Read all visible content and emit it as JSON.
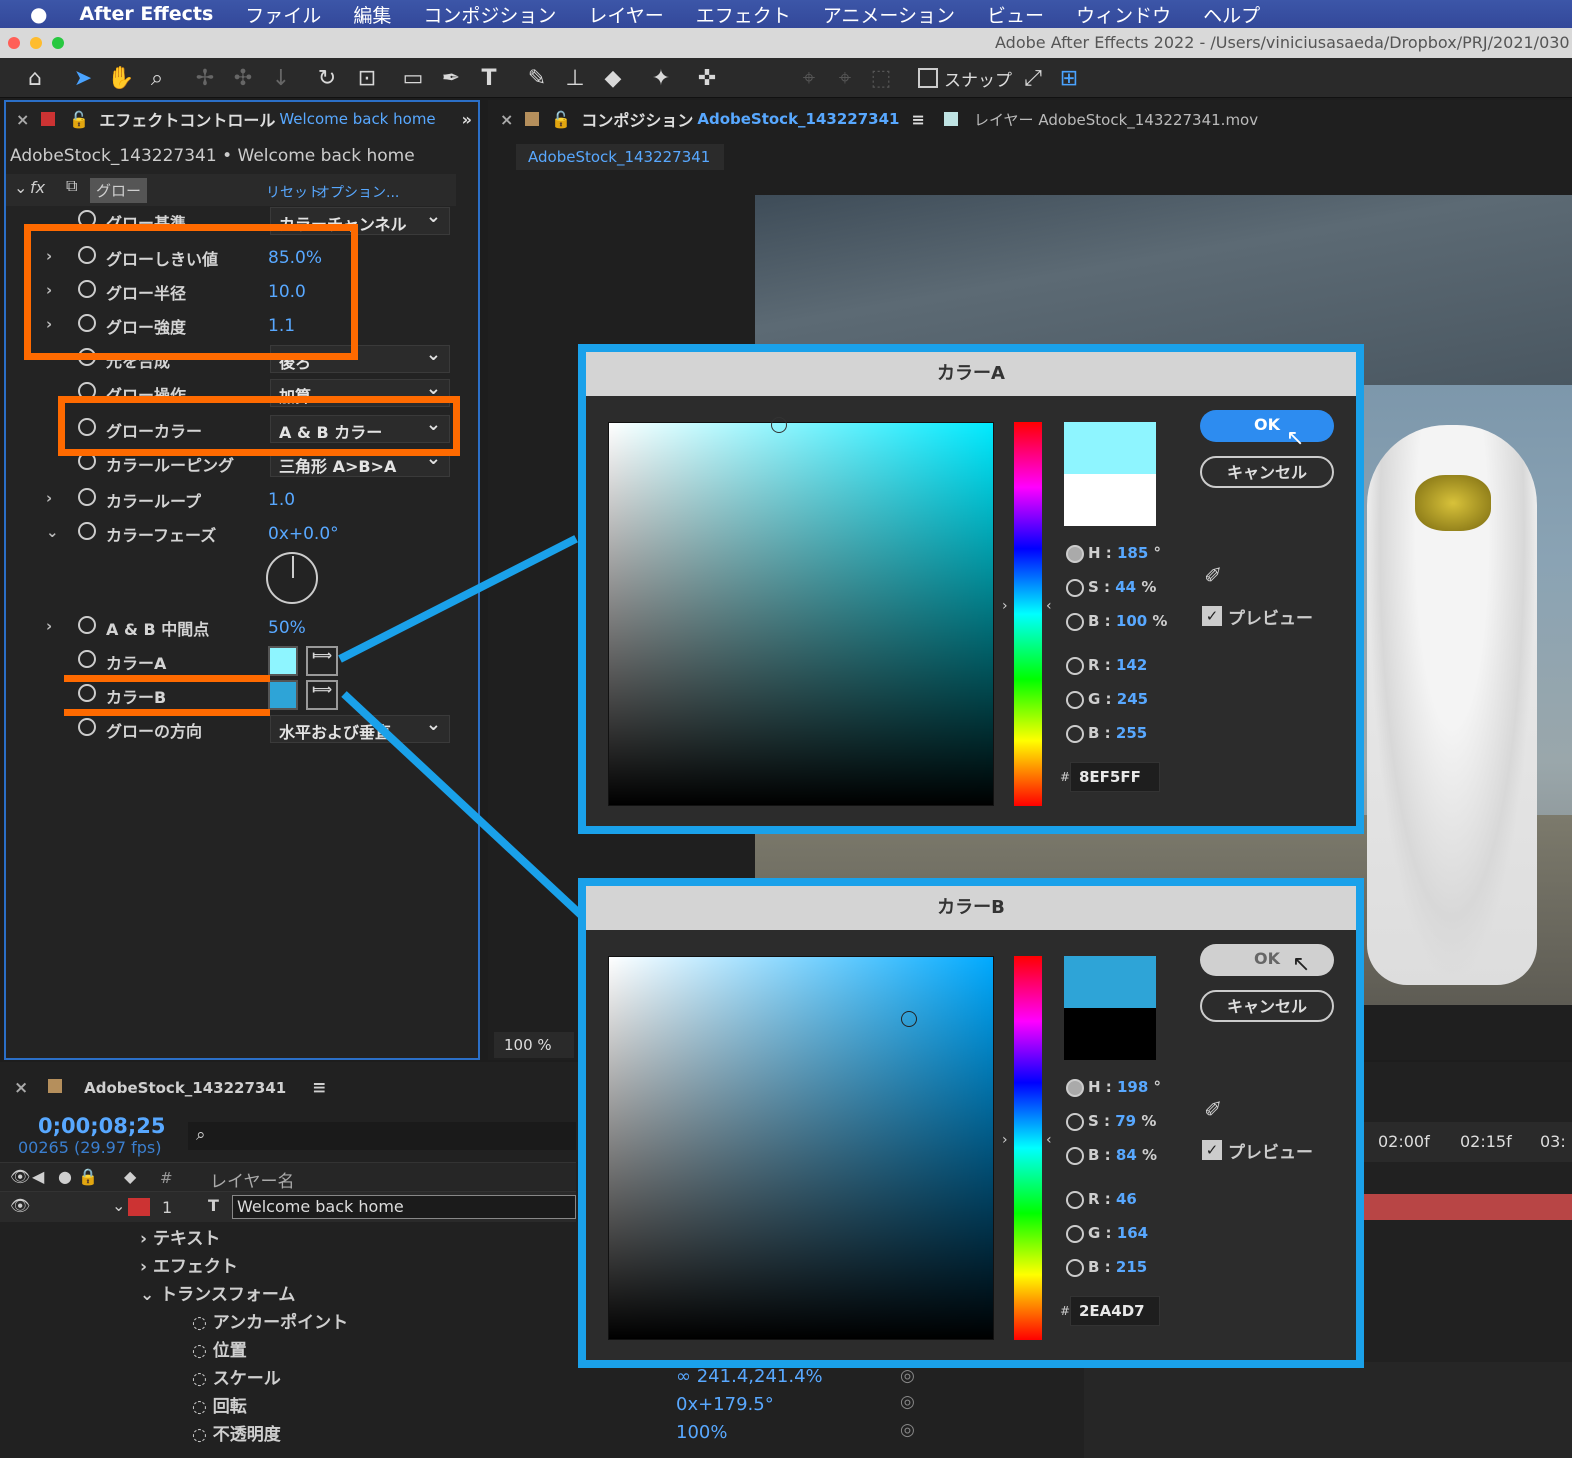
{
  "menubar": {
    "items": [
      "After Effects",
      "ファイル",
      "編集",
      "コンポジション",
      "レイヤー",
      "エフェクト",
      "アニメーション",
      "ビュー",
      "ウィンドウ",
      "ヘルプ"
    ]
  },
  "titlebar": {
    "title": "Adobe After Effects 2022 - /Users/viniciusasaeda/Dropbox/PRJ/2021/030"
  },
  "toolbar": {
    "snap_label": "スナップ"
  },
  "effect_panel": {
    "tab_title": "エフェクトコントロール",
    "tab_layer": "Welcome back home",
    "subtitle": "AdobeStock_143227341 • Welcome back home",
    "effect_name": "グロー",
    "reset": "リセット",
    "options": "オプション...",
    "rows": [
      {
        "label": "グロー基準",
        "value": "カラーチャンネル"
      },
      {
        "label": "グローしきい値",
        "value": "85.0%"
      },
      {
        "label": "グロー半径",
        "value": "10.0"
      },
      {
        "label": "グロー強度",
        "value": "1.1"
      },
      {
        "label": "元を合成",
        "value": "後ろ"
      },
      {
        "label": "グロー操作",
        "value": "加算"
      },
      {
        "label": "グローカラー",
        "value": "A & B カラー"
      },
      {
        "label": "カラールーピング",
        "value": "三角形 A>B>A"
      },
      {
        "label": "カラーループ",
        "value": "1.0"
      },
      {
        "label": "カラーフェーズ",
        "value": "0x+0.0°"
      },
      {
        "label": "A & B 中間点",
        "value": "50%"
      },
      {
        "label": "カラーA",
        "value": ""
      },
      {
        "label": "カラーB",
        "value": ""
      },
      {
        "label": "グローの方向",
        "value": "水平および垂直"
      }
    ]
  },
  "comp_panel": {
    "tab_title": "コンポジション",
    "tab_comp": "AdobeStock_143227341",
    "layer_tab": "レイヤー AdobeStock_143227341.mov",
    "subtab": "AdobeStock_143227341",
    "zoom": "100 %"
  },
  "timeline": {
    "comp_name": "AdobeStock_143227341",
    "timecode": "0;00;08;25",
    "frames": "00265 (29.97 fps)",
    "col_num": "#",
    "col_layer": "レイヤー名",
    "layer_num": "1",
    "layer_name": "Welcome back home",
    "children": [
      "テキスト",
      "エフェクト",
      "トランスフォーム"
    ],
    "transform": [
      "アンカーポイント",
      "位置",
      "スケール",
      "回転",
      "不透明度"
    ],
    "scale_value": "241.4,241.4%",
    "rotation_value": "0x+179.5°",
    "opacity_value": "100%",
    "ruler": [
      "02:00f",
      "02:15f",
      "03:"
    ]
  },
  "dialog_a": {
    "title": "カラーA",
    "ok": "OK",
    "cancel": "キャンセル",
    "h": "185",
    "s": "44",
    "b": "100",
    "r": "142",
    "g": "245",
    "b2": "255",
    "hex": "8EF5FF",
    "preview": "プレビュー",
    "color_new": "#8ef5ff",
    "color_old": "#ffffff",
    "field_hue": "#00eaff"
  },
  "dialog_b": {
    "title": "カラーB",
    "ok": "OK",
    "cancel": "キャンセル",
    "h": "198",
    "s": "79",
    "b": "84",
    "r": "46",
    "g": "164",
    "b2": "215",
    "hex": "2EA4D7",
    "preview": "プレビュー",
    "color_new": "#2ea4d7",
    "color_old": "#000000",
    "field_hue": "#00aaff"
  },
  "colors": {
    "accent_blue": "#58a8ff",
    "highlight_orange": "#ff6a00",
    "callout_blue": "#1aa1ea",
    "layer_label_red": "#c33"
  }
}
